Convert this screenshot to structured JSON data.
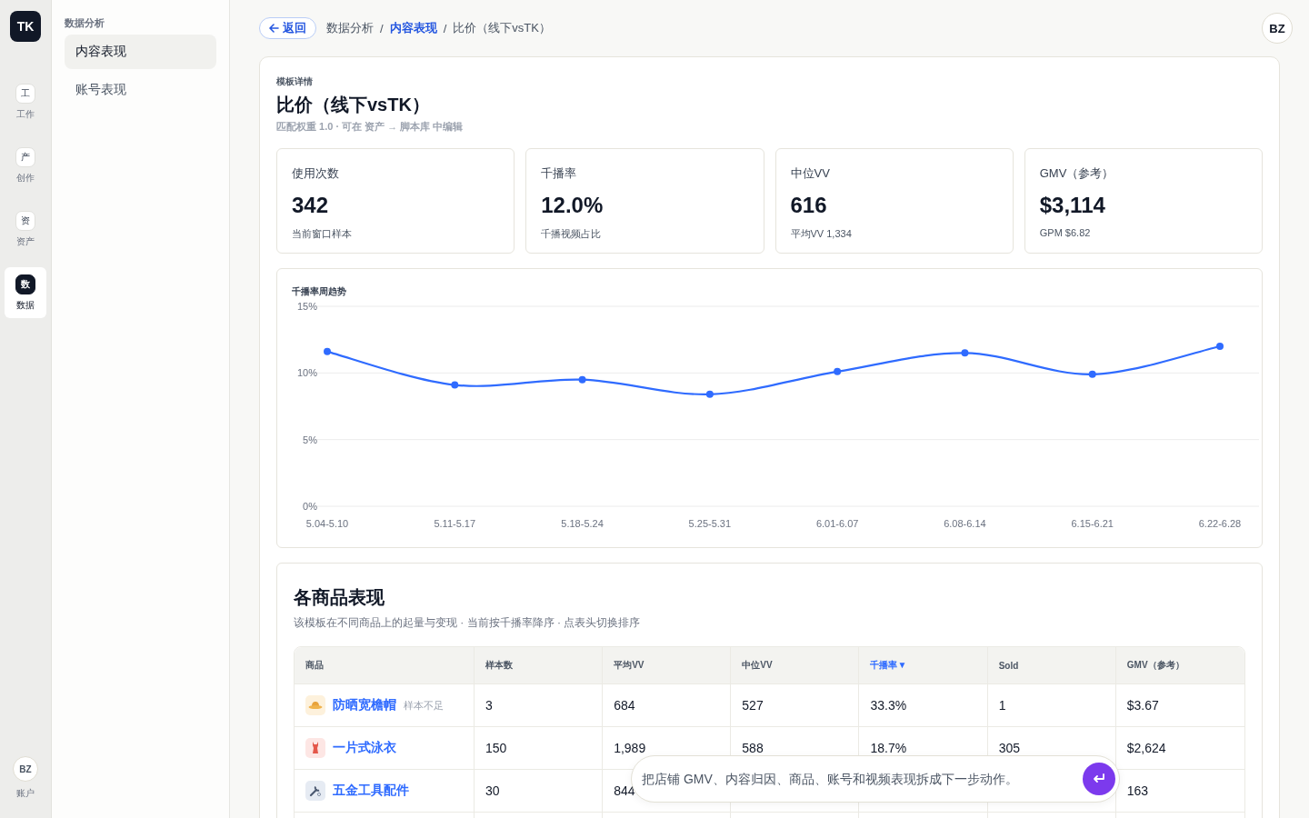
{
  "logo": "TK",
  "rail": [
    {
      "glyph": "工",
      "label": "工作",
      "selected": false
    },
    {
      "glyph": "产",
      "label": "创作",
      "selected": false
    },
    {
      "glyph": "资",
      "label": "资产",
      "selected": false
    },
    {
      "glyph": "数",
      "label": "数据",
      "selected": true
    }
  ],
  "rail_account": {
    "avatar": "BZ",
    "label": "账户"
  },
  "sidebar": {
    "section": "数据分析",
    "items": [
      {
        "label": "内容表现",
        "selected": true
      },
      {
        "label": "账号表现",
        "selected": false
      }
    ]
  },
  "topbar": {
    "back": "返回",
    "separators": [
      "/",
      "/"
    ],
    "breadcrumb": [
      {
        "label": "数据分析",
        "link": false
      },
      {
        "label": "内容表现",
        "link": true
      },
      {
        "label": "比价（线下vsTK）",
        "link": false
      }
    ],
    "avatar": "BZ"
  },
  "detail": {
    "eyebrow": "模板详情",
    "title": "比价（线下vsTK）",
    "subtitle": "匹配权重 1.0 · 可在 资产 → 脚本库 中编辑"
  },
  "kpis": [
    {
      "label": "使用次数",
      "value": "342",
      "note": "当前窗口样本"
    },
    {
      "label": "千播率",
      "value": "12.0%",
      "note": "千播视频占比"
    },
    {
      "label": "中位VV",
      "value": "616",
      "note": "平均VV 1,334"
    },
    {
      "label": "GMV（参考）",
      "value": "$3,114",
      "note": "GPM $6.82"
    }
  ],
  "trend": {
    "chart_data": {
      "type": "line",
      "title": "千播率周趋势",
      "categories": [
        "5.04-5.10",
        "5.11-5.17",
        "5.18-5.24",
        "5.25-5.31",
        "6.01-6.07",
        "6.08-6.14",
        "6.15-6.21",
        "6.22-6.28"
      ],
      "series": [
        {
          "color": "#2f6bff",
          "marker": true,
          "values": [
            11.6,
            9.1,
            9.5,
            8.4,
            10.1,
            11.5,
            9.9,
            12.0
          ]
        }
      ],
      "ylim": [
        0,
        15
      ],
      "yticks": [
        {
          "value": 0,
          "label": "0%"
        },
        {
          "value": 5,
          "label": "5%"
        },
        {
          "value": 10,
          "label": "10%"
        },
        {
          "value": 15,
          "label": "15%"
        }
      ]
    }
  },
  "products": {
    "title": "各商品表现",
    "subtitle": "该模板在不同商品上的起量与变现 · 当前按千播率降序 · 点表头切换排序",
    "columns": [
      {
        "label": "商品",
        "sorted": false
      },
      {
        "label": "样本数",
        "sorted": false
      },
      {
        "label": "平均VV",
        "sorted": false
      },
      {
        "label": "中位VV",
        "sorted": false
      },
      {
        "label": "千播率",
        "sorted": true,
        "sort_indicator": "▼"
      },
      {
        "label": "Sold",
        "sorted": false
      },
      {
        "label": "GMV（参考）",
        "sorted": false
      }
    ],
    "rows": [
      {
        "cells": [
          {
            "kind": "hat",
            "name": "防晒宽檐帽",
            "note": "样本不足"
          },
          "3",
          "684",
          "527",
          "33.3%",
          "1",
          "$3.67"
        ]
      },
      {
        "cells": [
          {
            "kind": "swimsuit",
            "name": "一片式泳衣"
          },
          "150",
          "1,989",
          "588",
          "18.7%",
          "305",
          "$2,624"
        ]
      },
      {
        "cells": [
          {
            "kind": "tool",
            "name": "五金工具配件"
          },
          "30",
          "844",
          null,
          null,
          null,
          "163"
        ]
      }
    ]
  },
  "assistant": {
    "placeholder": "把店铺 GMV、内容归因、商品、账号和视频表现拆成下一步动作。"
  }
}
